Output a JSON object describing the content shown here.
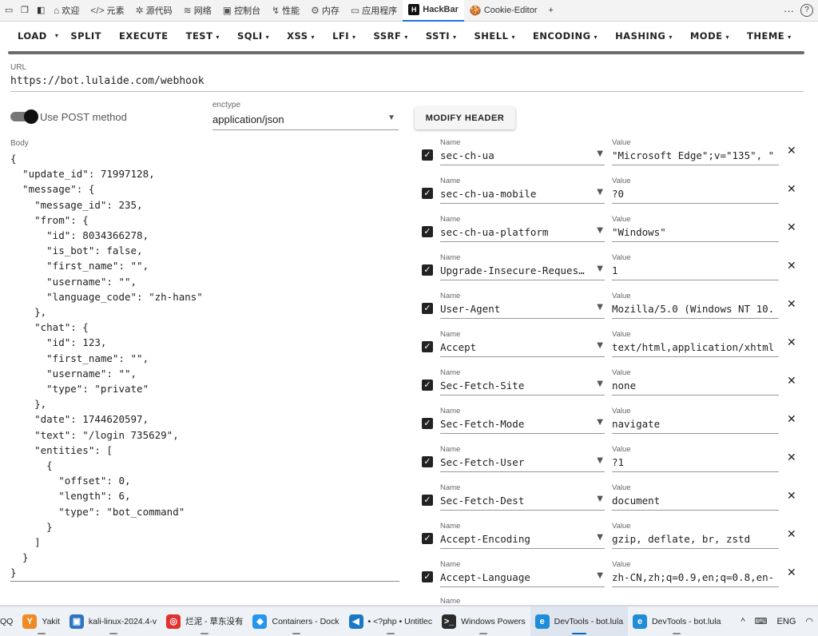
{
  "devtools": {
    "tabs": [
      {
        "icon": "⌂",
        "label": "欢迎"
      },
      {
        "icon": "</>",
        "label": "元素"
      },
      {
        "icon": "✲",
        "label": "源代码"
      },
      {
        "icon": "≋",
        "label": "网络"
      },
      {
        "icon": "▣",
        "label": "控制台"
      },
      {
        "icon": "↯",
        "label": "性能"
      },
      {
        "icon": "⚙",
        "label": "内存"
      },
      {
        "icon": "▭",
        "label": "应用程序"
      },
      {
        "icon": "H",
        "label": "HackBar"
      },
      {
        "icon": "🍪",
        "label": "Cookie-Editor"
      }
    ],
    "active_tab": "HackBar",
    "add_tab": "+",
    "more": "···",
    "help": "?"
  },
  "menu": {
    "load": "LOAD",
    "load_caret": "▾",
    "items": [
      "SPLIT",
      "EXECUTE",
      "TEST",
      "SQLI",
      "XSS",
      "LFI",
      "SSRF",
      "SSTI",
      "SHELL",
      "ENCODING",
      "HASHING",
      "MODE",
      "THEME"
    ],
    "caret": "▾"
  },
  "url": {
    "label": "URL",
    "value": "https://bot.lulaide.com/webhook"
  },
  "post_toggle": {
    "label": "Use POST method",
    "enabled": true
  },
  "enctype": {
    "label": "enctype",
    "value": "application/json"
  },
  "modify_header": "MODIFY HEADER",
  "body": {
    "label": "Body",
    "value": "{\n  \"update_id\": 71997128,\n  \"message\": {\n    \"message_id\": 235,\n    \"from\": {\n      \"id\": 8034366278,\n      \"is_bot\": false,\n      \"first_name\": \"\",\n      \"username\": \"\",\n      \"language_code\": \"zh-hans\"\n    },\n    \"chat\": {\n      \"id\": 123,\n      \"first_name\": \"\",\n      \"username\": \"\",\n      \"type\": \"private\"\n    },\n    \"date\": 1744620597,\n    \"text\": \"/login 735629\",\n    \"entities\": [\n      {\n        \"offset\": 0,\n        \"length\": 6,\n        \"type\": \"bot_command\"\n      }\n    ]\n  }\n}"
  },
  "headers": {
    "name_label": "Name",
    "value_label": "Value",
    "rows": [
      {
        "name": "sec-ch-ua",
        "value": "\"Microsoft Edge\";v=\"135\", \""
      },
      {
        "name": "sec-ch-ua-mobile",
        "value": "?0"
      },
      {
        "name": "sec-ch-ua-platform",
        "value": "\"Windows\""
      },
      {
        "name": "Upgrade-Insecure-Requests",
        "value": "1"
      },
      {
        "name": "User-Agent",
        "value": "Mozilla/5.0 (Windows NT 10."
      },
      {
        "name": "Accept",
        "value": "text/html,application/xhtml"
      },
      {
        "name": "Sec-Fetch-Site",
        "value": "none"
      },
      {
        "name": "Sec-Fetch-Mode",
        "value": "navigate"
      },
      {
        "name": "Sec-Fetch-User",
        "value": "?1"
      },
      {
        "name": "Sec-Fetch-Dest",
        "value": "document"
      },
      {
        "name": "Accept-Encoding",
        "value": "gzip, deflate, br, zstd"
      },
      {
        "name": "Accept-Language",
        "value": "zh-CN,zh;q=0.9,en;q=0.8,en-"
      }
    ]
  },
  "taskbar": {
    "items": [
      {
        "label": "QQ",
        "icon": "",
        "color": "#ffffff"
      },
      {
        "label": "Yakit",
        "icon": "Y",
        "color": "#f08a24"
      },
      {
        "label": "kali-linux-2024.4-v",
        "icon": "▣",
        "color": "#2f74c0"
      },
      {
        "label": "烂泥 - 草东没有",
        "icon": "◎",
        "color": "#e0312f"
      },
      {
        "label": "Containers - Dock",
        "icon": "◆",
        "color": "#2496ed"
      },
      {
        "label": "• <?php • Untitlec",
        "icon": "◀",
        "color": "#1b78c7"
      },
      {
        "label": "Windows Powers",
        "icon": ">_",
        "color": "#2b2b2b"
      },
      {
        "label": "DevTools - bot.lula",
        "icon": "e",
        "color": "#1e8cd6"
      },
      {
        "label": "DevTools - bot.lula",
        "icon": "e",
        "color": "#1e8cd6"
      }
    ],
    "active_index": 7,
    "tray": {
      "chevron": "^",
      "keyboard": "⌨",
      "lang": "ENG",
      "wifi": "◠"
    }
  }
}
